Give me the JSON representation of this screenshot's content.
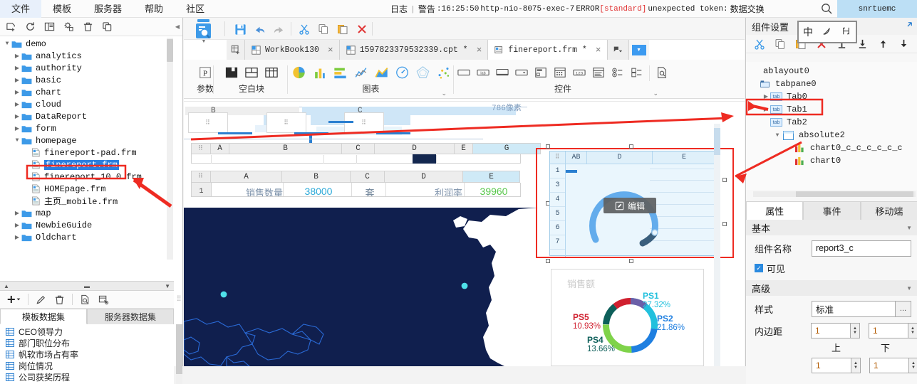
{
  "menubar": {
    "items": [
      {
        "label": "文件",
        "name": "menu-file"
      },
      {
        "label": "模板",
        "name": "menu-template"
      },
      {
        "label": "服务器",
        "name": "menu-server"
      },
      {
        "label": "帮助",
        "name": "menu-help"
      },
      {
        "label": "社区",
        "name": "menu-community"
      }
    ],
    "status": {
      "log_label": "日志",
      "separator": "|",
      "warn_label": "警告",
      "timestamp": ":16:25:50",
      "thread": "http-nio-8075-exec-7",
      "level": "ERROR",
      "scope": "[standard]",
      "message": "unexpected token:",
      "message_cn": "数据交换"
    },
    "search_icon": "search-icon",
    "user": "snrtuemc"
  },
  "left_panel": {
    "toolbar_icons": [
      "new-template-icon",
      "refresh-icon",
      "report-icon",
      "settings-icon",
      "delete-icon",
      "copy-icon"
    ],
    "tree": [
      {
        "label": "demo",
        "depth": 0,
        "type": "folder",
        "arrow": "down",
        "selected": false
      },
      {
        "label": "analytics",
        "depth": 1,
        "type": "folder",
        "arrow": "right",
        "selected": false
      },
      {
        "label": "authority",
        "depth": 1,
        "type": "folder",
        "arrow": "right",
        "selected": false
      },
      {
        "label": "basic",
        "depth": 1,
        "type": "folder",
        "arrow": "right",
        "selected": false
      },
      {
        "label": "chart",
        "depth": 1,
        "type": "folder",
        "arrow": "right",
        "selected": false
      },
      {
        "label": "cloud",
        "depth": 1,
        "type": "folder",
        "arrow": "right",
        "selected": false
      },
      {
        "label": "DataReport",
        "depth": 1,
        "type": "folder",
        "arrow": "right",
        "selected": false
      },
      {
        "label": "form",
        "depth": 1,
        "type": "folder",
        "arrow": "right",
        "selected": false
      },
      {
        "label": "homepage",
        "depth": 1,
        "type": "folder",
        "arrow": "down",
        "selected": false
      },
      {
        "label": "finereport-pad.frm",
        "depth": 2,
        "type": "file",
        "arrow": "",
        "selected": false
      },
      {
        "label": "finereport.frm",
        "depth": 2,
        "type": "file",
        "arrow": "",
        "selected": true
      },
      {
        "label": "finereport_10.0.frm",
        "depth": 2,
        "type": "file",
        "arrow": "",
        "selected": false
      },
      {
        "label": "HOMEpage.frm",
        "depth": 2,
        "type": "file",
        "arrow": "",
        "selected": false
      },
      {
        "label": "主页_mobile.frm",
        "depth": 2,
        "type": "file",
        "arrow": "",
        "selected": false
      },
      {
        "label": "map",
        "depth": 1,
        "type": "folder",
        "arrow": "right",
        "selected": false
      },
      {
        "label": "NewbieGuide",
        "depth": 1,
        "type": "folder",
        "arrow": "right",
        "selected": false
      },
      {
        "label": "Oldchart",
        "depth": 1,
        "type": "folder",
        "arrow": "right",
        "selected": false
      }
    ],
    "dataset": {
      "toolbar_icons": [
        "add-icon",
        "edit-icon",
        "delete-icon",
        "preview-icon",
        "sql-icon"
      ],
      "tabs": [
        {
          "label": "模板数据集",
          "active": true
        },
        {
          "label": "服务器数据集",
          "active": false
        }
      ],
      "items": [
        "CEO领导力",
        "部门职位分布",
        "帆软市场占有率",
        "岗位情况",
        "公司获奖历程"
      ]
    }
  },
  "center": {
    "toolbar_icons": [
      "save-icon",
      "undo-icon",
      "redo-icon",
      "cut-icon",
      "copy-icon",
      "paste-icon",
      "delete-icon"
    ],
    "logo_icon": "finereport-logo-icon",
    "tabs": [
      {
        "label": "WorkBook130",
        "active": false,
        "icon": "workbook-icon",
        "close": "×"
      },
      {
        "label": "1597823379532339.cpt *",
        "active": false,
        "icon": "cpt-icon",
        "close": "×"
      },
      {
        "label": "finereport.frm *",
        "active": true,
        "icon": "frm-icon",
        "close": "×"
      }
    ],
    "ribbon": [
      {
        "name": "params-group",
        "label": "参数",
        "icons": [
          "parameter-p-icon"
        ],
        "chevron": false
      },
      {
        "name": "blank-block-group",
        "label": "空白块",
        "icons": [
          "block-solid-icon",
          "block-split-icon",
          "block-grid-icon"
        ],
        "chevron": false
      },
      {
        "name": "chart-group",
        "label": "图表",
        "icons": [
          "pie-chart-icon",
          "column-chart-icon",
          "bar-chart-icon",
          "line-chart-icon",
          "area-chart-icon",
          "gauge-chart-icon",
          "radar-chart-icon",
          "scatter-chart-icon"
        ],
        "chevron": true
      },
      {
        "name": "widget-group",
        "label": "控件",
        "icons": [
          "textfield-icon",
          "label-icon",
          "textarea-icon",
          "combobox-icon",
          "panel-icon",
          "datepicker-icon",
          "number-icon",
          "list-icon",
          "radio-icon",
          "checkbox-icon",
          "preview-icon"
        ],
        "chevron": true
      }
    ],
    "canvas": {
      "pixel_label": "786像素",
      "ruler_letters": [
        "B",
        "C"
      ],
      "sheet_top": {
        "columns": [
          "A",
          "B",
          "C",
          "D",
          "E",
          "G"
        ],
        "highlight": "G"
      },
      "sheet_data": {
        "columns": [
          "A",
          "B",
          "C",
          "D",
          "E"
        ],
        "highlight": "E",
        "rows": [
          {
            "num": "1",
            "cells": [
              "销售数量",
              "38000",
              "套",
              "利润率",
              "39960"
            ]
          }
        ]
      },
      "gauge": {
        "edit_badge": "编辑",
        "edit_icon": "edit-pencil-icon",
        "row_headers": [
          "1",
          "3",
          "4",
          "5",
          "6",
          "7"
        ],
        "col_headers": [
          "AB",
          "D",
          "E"
        ]
      },
      "donut": {
        "title": "销售额",
        "slices": [
          {
            "label": "PS1",
            "value": "27.32%",
            "color": "#22c0dd"
          },
          {
            "label": "PS2",
            "value": "21.86%",
            "color": "#1f7fe0"
          },
          {
            "label": "PS4",
            "value": "13.66%",
            "color": "#0d5f5a"
          },
          {
            "label": "PS5",
            "value": "10.93%",
            "color": "#d0202f"
          }
        ]
      }
    }
  },
  "right_panel": {
    "title": "组件设置",
    "expand_icon": "expand-arrow-icon",
    "ime_overlay": [
      "中",
      "pen-icon",
      "half-width-icon"
    ],
    "toolbar_icons": [
      "cut-icon",
      "copy-icon",
      "paste-icon",
      "delete-icon",
      "align-top-icon",
      "align-bottom-icon",
      "move-up-icon",
      "move-down-icon"
    ],
    "tree": [
      {
        "label": "ablayout0",
        "depth": 0,
        "type": "layout",
        "arrow": ""
      },
      {
        "label": "tabpane0",
        "depth": 0,
        "type": "tabpane",
        "arrow": ""
      },
      {
        "label": "Tab0",
        "depth": 1,
        "type": "tab",
        "arrow": "right"
      },
      {
        "label": "Tab1",
        "depth": 1,
        "type": "tab",
        "arrow": "right"
      },
      {
        "label": "Tab2",
        "depth": 1,
        "type": "tab",
        "arrow": "",
        "highlighted": true
      },
      {
        "label": "absolute2",
        "depth": 2,
        "type": "absolute",
        "arrow": "down"
      },
      {
        "label": "chart0_c_c_c_c_c_c",
        "depth": 3,
        "type": "chart",
        "arrow": ""
      },
      {
        "label": "chart0",
        "depth": 3,
        "type": "chart",
        "arrow": ""
      }
    ],
    "tabs": [
      {
        "label": "属性",
        "active": true
      },
      {
        "label": "事件",
        "active": false
      },
      {
        "label": "移动端",
        "active": false
      }
    ],
    "sections": [
      {
        "title": "基本",
        "rows": [
          {
            "type": "text",
            "label": "组件名称",
            "value": "report3_c"
          },
          {
            "type": "checkbox",
            "label": "可见",
            "checked": true
          }
        ]
      },
      {
        "title": "高级",
        "rows": [
          {
            "type": "style",
            "label": "样式",
            "value": "标准",
            "more": "..."
          },
          {
            "type": "padding",
            "label": "内边距",
            "values": [
              "1",
              "1",
              "1",
              "1"
            ],
            "sub_labels": [
              "上",
              "下"
            ]
          }
        ]
      }
    ]
  }
}
